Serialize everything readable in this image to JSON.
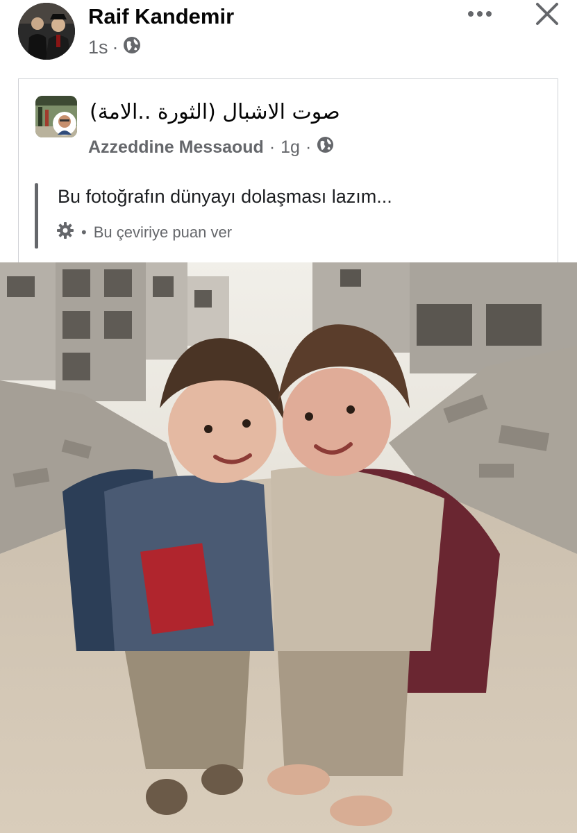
{
  "post": {
    "author_name": "Raif Kandemir",
    "time": "1s",
    "separator": "·",
    "privacy_icon": "globe-icon",
    "more_icon": "more-dots-icon",
    "close_icon": "close-icon"
  },
  "shared": {
    "page_name": "صوت الاشبال (الثورة ..الامة)",
    "author": "Azzeddine Messaoud",
    "separator": "·",
    "time": "1g",
    "privacy_icon": "globe-icon",
    "translated_text": "Bu fotoğrafın dünyayı dolaşması lazım...",
    "settings_icon": "gear-icon",
    "rate_separator": "•",
    "rate_label": "Bu çeviriye puan ver"
  },
  "colors": {
    "text": "#050505",
    "secondary": "#65676b",
    "border": "#d0d2d6"
  }
}
